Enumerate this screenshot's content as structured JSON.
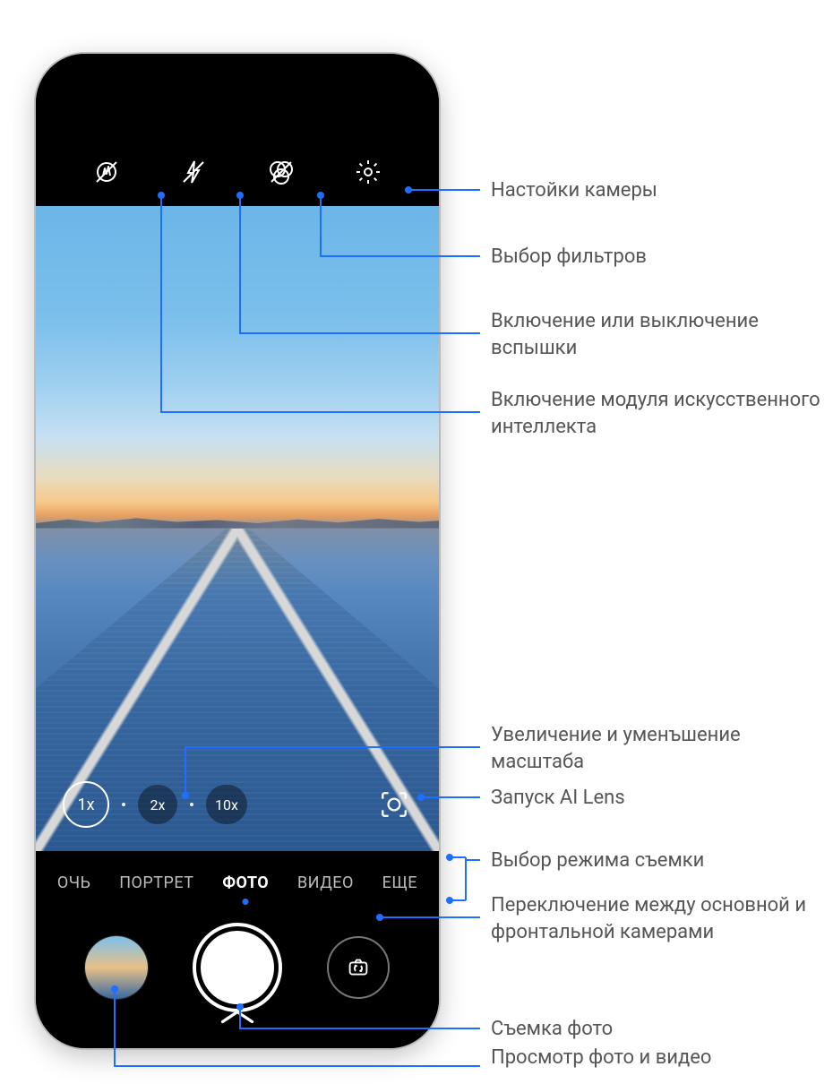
{
  "zoom": {
    "x1": "1x",
    "x2": "2x",
    "x10": "10x"
  },
  "modes": {
    "night_truncated": "ОЧЬ",
    "portrait": "ПОРТРЕТ",
    "photo": "ФОТО",
    "video": "ВИДЕО",
    "more": "ЕЩЕ"
  },
  "callouts": {
    "settings": "Настойки камеры",
    "filters": "Выбор фильтров",
    "flash": "Включение или выключение вспышки",
    "ai_module": "Включение модуля искусственного интеллекта",
    "zoom": "Увеличение и уменъшение масштаба",
    "ai_lens": "Запуск AI Lens",
    "mode_select": "Выбор режима съемки",
    "switch_cam": "Переключение между основной и фронтальной камерами",
    "shutter": "Съемка фото",
    "gallery": "Просмотр фото и видео"
  }
}
